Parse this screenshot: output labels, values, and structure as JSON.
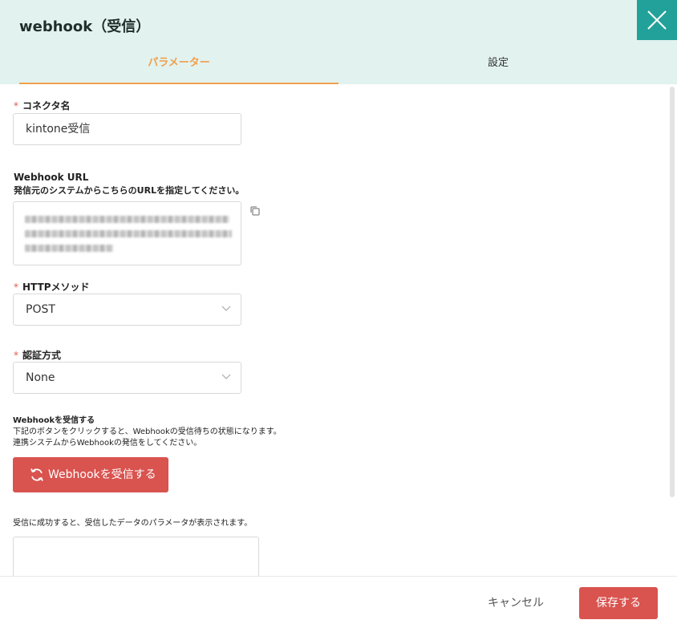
{
  "header": {
    "title": "webhook（受信）",
    "close_icon": "close-icon"
  },
  "tabs": [
    {
      "label": "パラメーター",
      "active": true
    },
    {
      "label": "設定",
      "active": false
    }
  ],
  "form": {
    "connector_name": {
      "label": "コネクタ名",
      "required_mark": "*",
      "value": "kintone受信"
    },
    "webhook_url": {
      "label": "Webhook URL",
      "description": "発信元のシステムからこちらのURLを指定してください。",
      "copy_icon": "copy-icon"
    },
    "http_method": {
      "label": "HTTPメソッド",
      "required_mark": "*",
      "value": "POST"
    },
    "auth_method": {
      "label": "認証方式",
      "required_mark": "*",
      "value": "None"
    },
    "receive": {
      "heading": "Webhookを受信する",
      "line1": "下記のボタンをクリックすると、Webhookの受信待ちの状態になります。",
      "line2": "連携システムからWebhookの発信をしてください。",
      "button_label": "Webhookを受信する",
      "button_icon": "refresh-icon"
    },
    "result": {
      "description": "受信に成功すると、受信したデータのパラメータが表示されます。"
    }
  },
  "footer": {
    "cancel_label": "キャンセル",
    "save_label": "保存する"
  },
  "colors": {
    "header_bg": "#e2f2ef",
    "close_bg": "#22a19a",
    "active_tab": "#f0a04b",
    "primary_button": "#d9534f",
    "required": "#e05a4a"
  }
}
